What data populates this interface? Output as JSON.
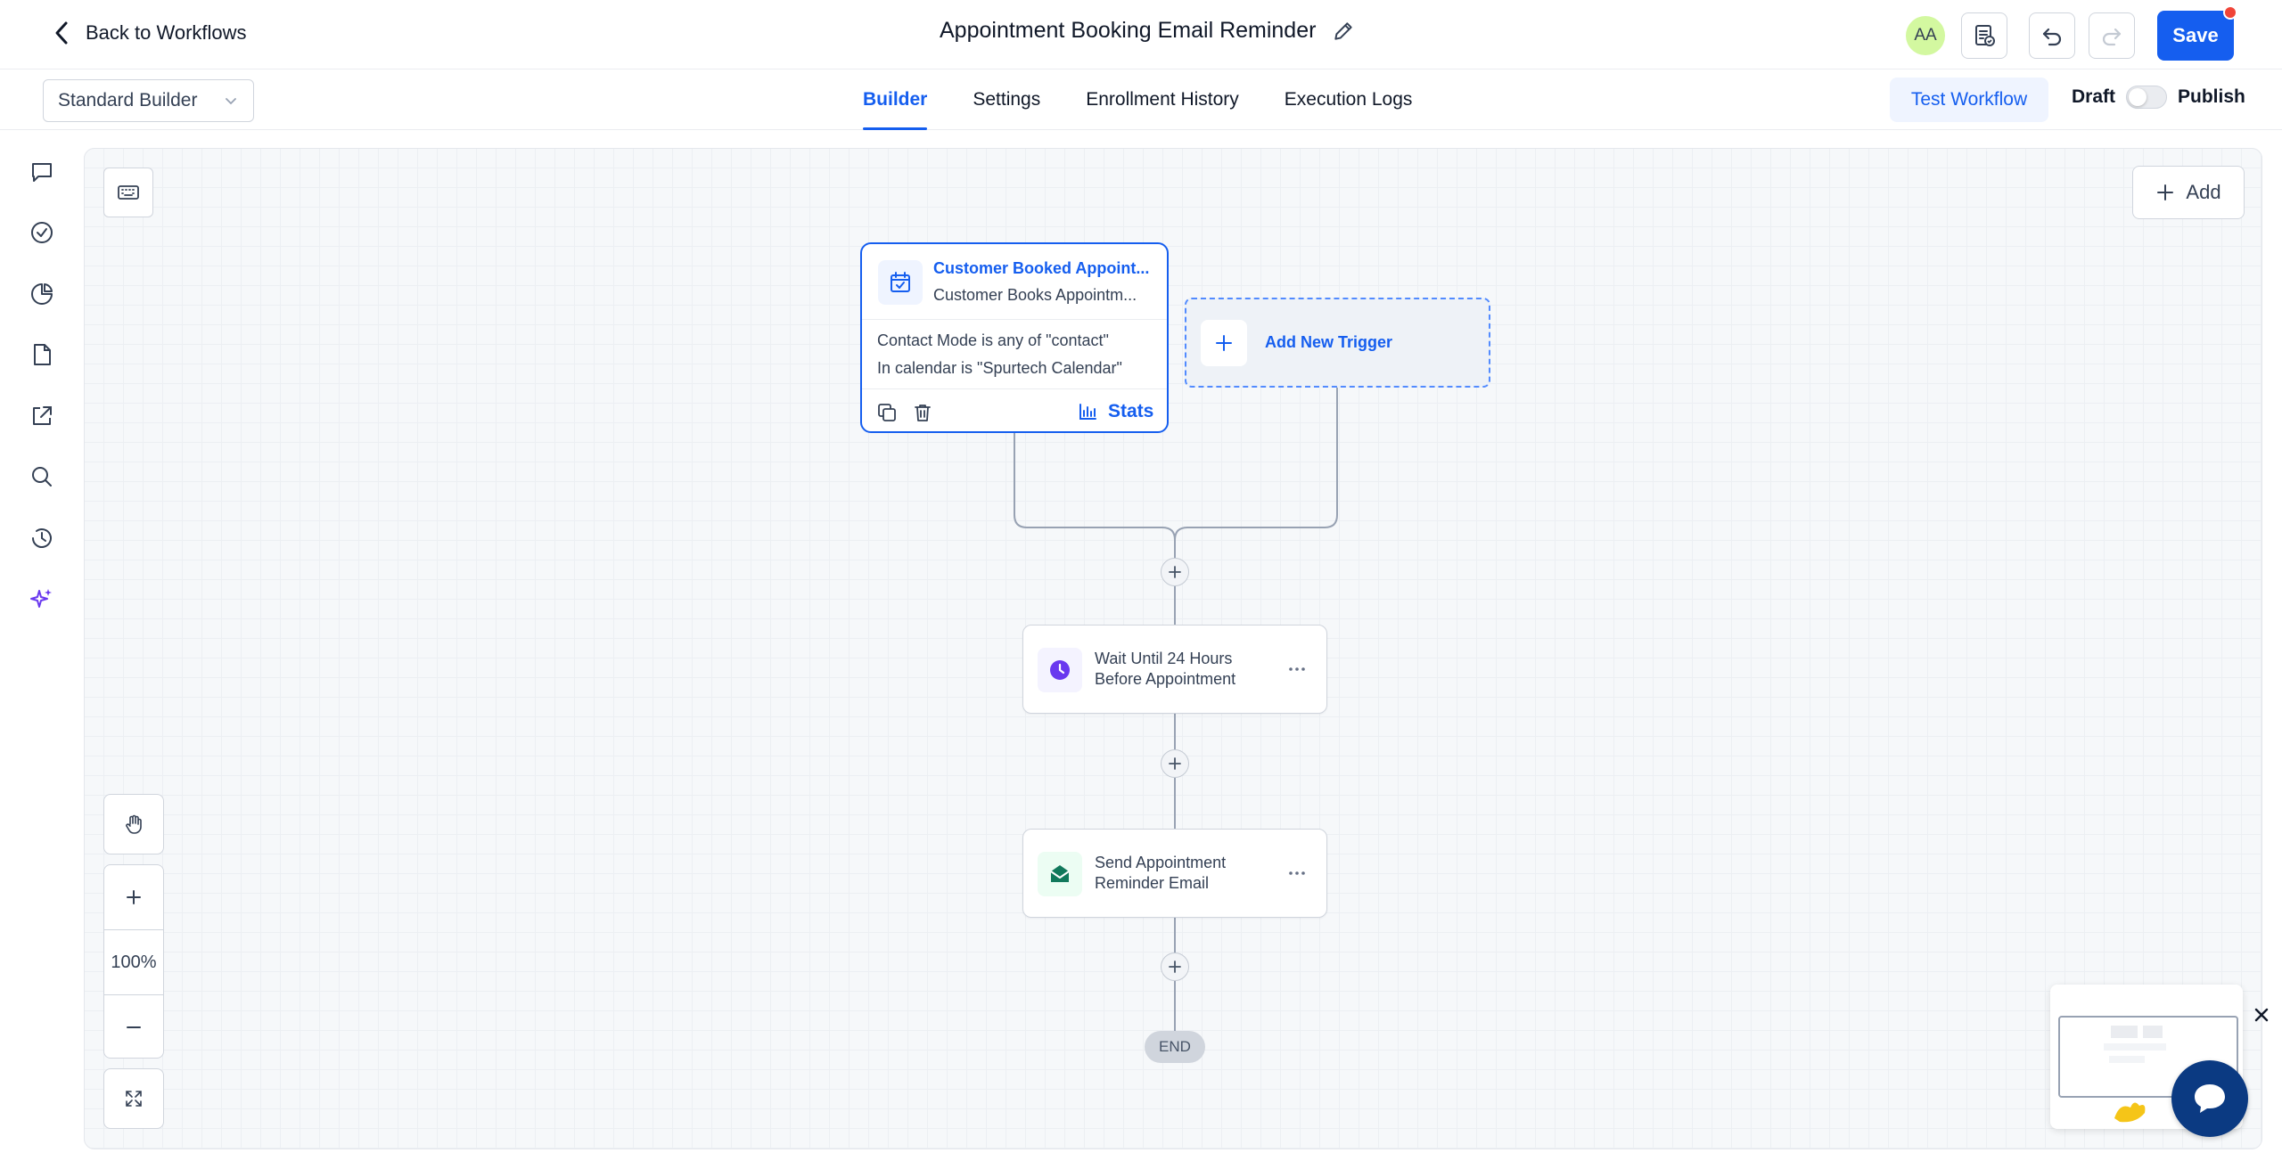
{
  "header": {
    "back_label": "Back to Workflows",
    "title": "Appointment Booking Email Reminder",
    "avatar_initials": "AA",
    "save_label": "Save"
  },
  "subheader": {
    "builder_mode": "Standard Builder",
    "tabs": [
      {
        "label": "Builder",
        "active": true
      },
      {
        "label": "Settings",
        "active": false
      },
      {
        "label": "Enrollment History",
        "active": false
      },
      {
        "label": "Execution Logs",
        "active": false
      }
    ],
    "test_workflow_label": "Test Workflow",
    "draft_label": "Draft",
    "publish_label": "Publish"
  },
  "sidebar": {
    "icons": [
      "chat-icon",
      "check-circle-icon",
      "pie-chart-icon",
      "document-icon",
      "external-link-icon",
      "search-icon",
      "history-icon",
      "sparkle-icon"
    ]
  },
  "canvas": {
    "add_label": "Add",
    "trigger": {
      "title": "Customer Booked Appoint...",
      "subtitle": "Customer Books Appointm...",
      "condition_1": "Contact Mode is any of \"contact\"",
      "condition_2": "In calendar is \"Spurtech Calendar\"",
      "stats_label": "Stats"
    },
    "add_trigger_label": "Add New Trigger",
    "actions": [
      {
        "line1": "Wait Until 24 Hours",
        "line2": "Before Appointment",
        "icon": "clock-icon",
        "color": "#6938ef"
      },
      {
        "line1": "Send Appointment",
        "line2": "Reminder Email",
        "icon": "email-icon",
        "color": "#12795c"
      }
    ],
    "end_label": "END",
    "zoom_level": "100%"
  },
  "colors": {
    "accent": "#155eef",
    "canvas_bg": "#f6f8fa",
    "notification": "#f04438"
  }
}
